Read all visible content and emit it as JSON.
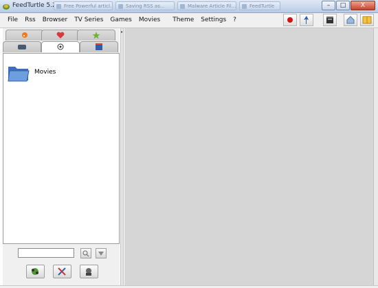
{
  "window": {
    "title": "FeedTurtle 5.2",
    "task_items": [
      "Free Powerful articl...",
      "Saving RSS as...",
      "Malware Article Fil...",
      "FeedTurtle"
    ],
    "buttons": {
      "minimize": "–",
      "maximize": "□",
      "close": "X"
    }
  },
  "menubar": {
    "items": [
      "File",
      "Rss",
      "Browser",
      "TV Series",
      "Games",
      "Movies",
      "Theme",
      "Settings",
      "?"
    ]
  },
  "toolbar": {
    "icons": [
      "record-icon",
      "pin-icon",
      "clapperboard-icon",
      "home-icon",
      "layout-icon"
    ],
    "colors": {
      "record": "#d31414",
      "pin": "#2b62b6"
    }
  },
  "leftpanel": {
    "tabs_top": [
      "rss-icon",
      "heart-icon",
      "star-icon"
    ],
    "tabs_bottom": [
      "tv-icon",
      "gamepad-icon",
      "movie-icon"
    ],
    "folder": {
      "label": "Movies",
      "icon": "folder-icon"
    },
    "search": {
      "value": "",
      "placeholder": ""
    },
    "bottom_buttons": [
      "add-icon",
      "tools-icon",
      "robot-icon"
    ]
  },
  "colors": {
    "workspace": "#d6d6d6",
    "panel_bg": "#ffffff",
    "folder": "#5b8fd4"
  }
}
